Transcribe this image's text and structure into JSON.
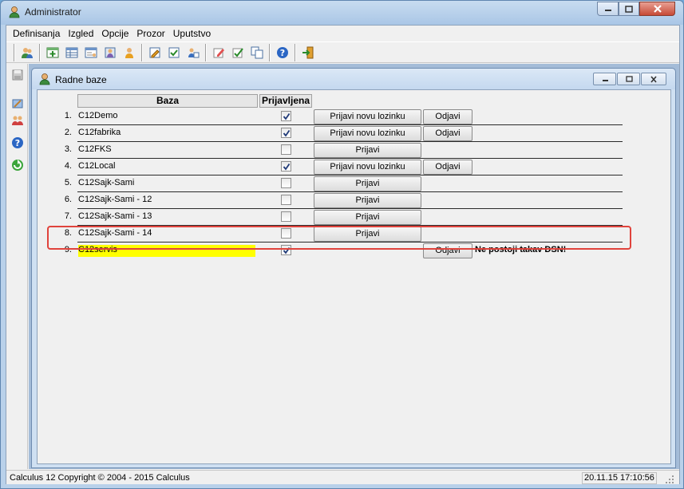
{
  "window": {
    "title": "Administrator"
  },
  "menu": [
    "Definisanja",
    "Izgled",
    "Opcije",
    "Prozor",
    "Uputstvo"
  ],
  "toolbar_icons": [
    "users-icon",
    "add-record-icon",
    "table-icon",
    "form-icon",
    "user-form-icon",
    "user-icon",
    "edit-icon",
    "check-icon",
    "person-edit-icon",
    "write-icon",
    "approve-icon",
    "copy-icon",
    "help-icon",
    "exit-icon"
  ],
  "sidebar_icons": [
    "save-icon",
    "tools-icon",
    "group-icon",
    "help-icon",
    "refresh-icon"
  ],
  "child": {
    "title": "Radne baze"
  },
  "table": {
    "headers": {
      "baza": "Baza",
      "prijavljena": "Prijavljena"
    },
    "rows": [
      {
        "num": "1.",
        "name": "C12Demo",
        "checked": true,
        "b1": "Prijavi novu lozinku",
        "b2": "Odjavi",
        "msg": ""
      },
      {
        "num": "2.",
        "name": "C12fabrika",
        "checked": true,
        "b1": "Prijavi novu lozinku",
        "b2": "Odjavi",
        "msg": ""
      },
      {
        "num": "3.",
        "name": "C12FKS",
        "checked": false,
        "b1": "Prijavi",
        "b2": "",
        "msg": ""
      },
      {
        "num": "4.",
        "name": "C12Local",
        "checked": true,
        "b1": "Prijavi novu lozinku",
        "b2": "Odjavi",
        "msg": ""
      },
      {
        "num": "5.",
        "name": "C12Sajk-Sami",
        "checked": false,
        "b1": "Prijavi",
        "b2": "",
        "msg": ""
      },
      {
        "num": "6.",
        "name": "C12Sajk-Sami - 12",
        "checked": false,
        "b1": "Prijavi",
        "b2": "",
        "msg": ""
      },
      {
        "num": "7.",
        "name": "C12Sajk-Sami - 13",
        "checked": false,
        "b1": "Prijavi",
        "b2": "",
        "msg": ""
      },
      {
        "num": "8.",
        "name": "C12Sajk-Sami - 14",
        "checked": false,
        "b1": "Prijavi",
        "b2": "",
        "msg": ""
      },
      {
        "num": "9.",
        "name": "C12servis",
        "checked": true,
        "b1": "",
        "b2": "Odjavi",
        "msg": "Ne postoji takav DSN!",
        "highlight": true
      }
    ]
  },
  "status": {
    "left": "Calculus 12  Copyright © 2004 - 2015  Calculus",
    "right": "20.11.15 17:10:56"
  },
  "colors": {
    "highlight_bg": "#ffff00",
    "error_border": "#e0433c",
    "title_bg": "#b9d1ea"
  }
}
